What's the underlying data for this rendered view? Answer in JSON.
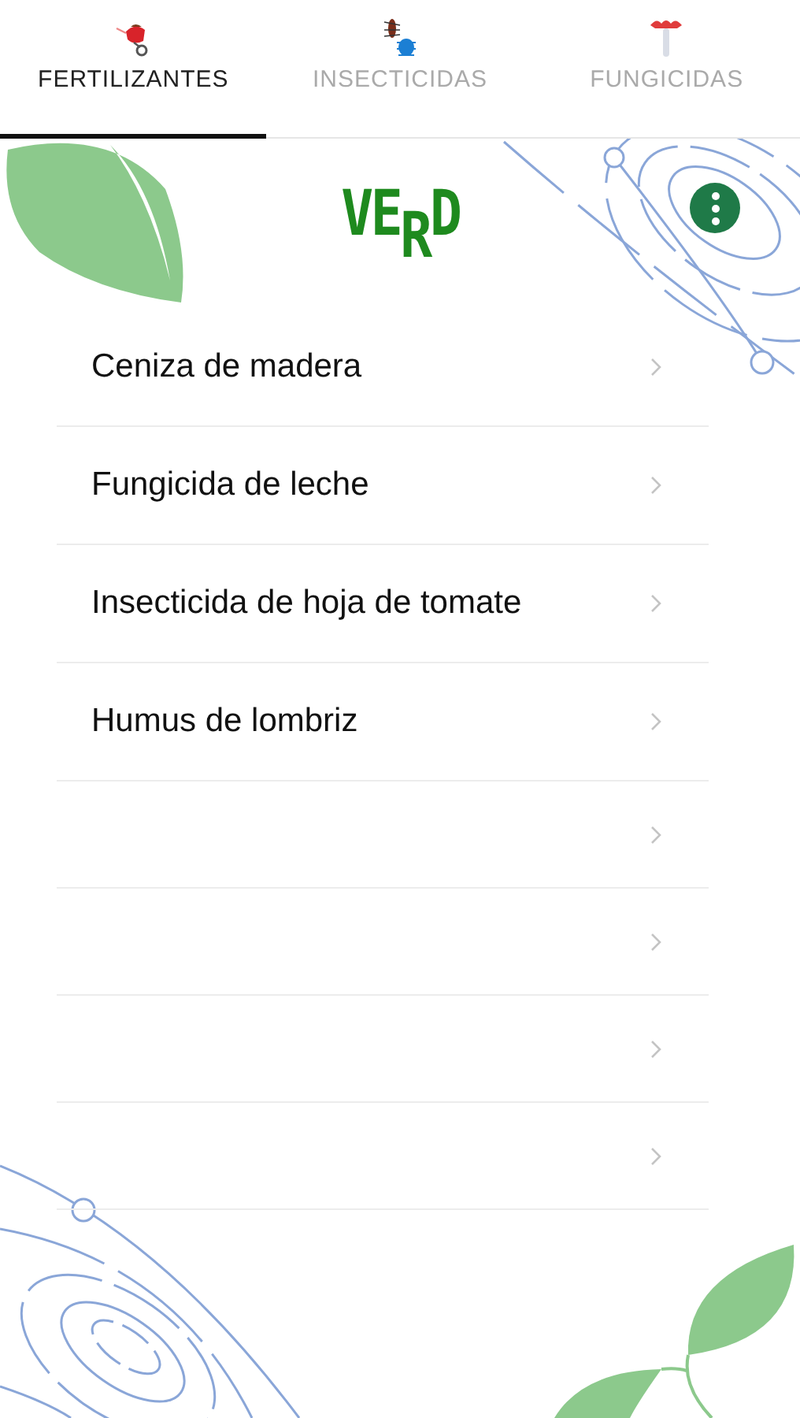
{
  "tabs": [
    {
      "label": "FERTILIZANTES",
      "selected": true
    },
    {
      "label": "INSECTICIDAS",
      "selected": false
    },
    {
      "label": "FUNGICIDAS",
      "selected": false
    }
  ],
  "header": {
    "logo": "VE$_{R}$D"
  },
  "list": [
    {
      "kind": "item",
      "label": "Ceniza de madera"
    },
    {
      "kind": "item",
      "label": "Fungicida de leche"
    },
    {
      "kind": "item",
      "label": "Insecticida de hoja de tomate"
    },
    {
      "kind": "item",
      "label": "Humus de lombriz"
    },
    {
      "kind": "empty"
    },
    {
      "kind": "empty"
    },
    {
      "kind": "empty"
    },
    {
      "kind": "empty"
    }
  ]
}
